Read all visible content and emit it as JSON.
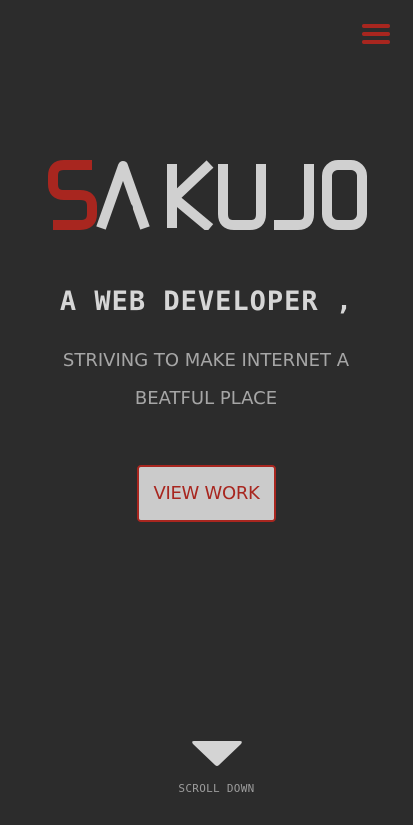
{
  "header": {
    "menu_icon": "hamburger-menu-icon",
    "menu_color": "#a8261f"
  },
  "hero": {
    "logo": {
      "first_letter": "S",
      "rest": "AKUJO",
      "accent_color": "#a8261f",
      "text_color": "#d0d0d0"
    },
    "headline": "A WEB DEVELOPER ,",
    "tagline": "STRIVING TO MAKE INTERNET A BEATFUL PLACE",
    "cta_label": "VIEW WORK"
  },
  "footer": {
    "scroll_icon": "triangle-down-icon",
    "scroll_label": "SCROLL DOWN"
  },
  "colors": {
    "background": "#2c2c2c",
    "accent": "#a8261f",
    "button_bg": "#cbcbcb"
  }
}
